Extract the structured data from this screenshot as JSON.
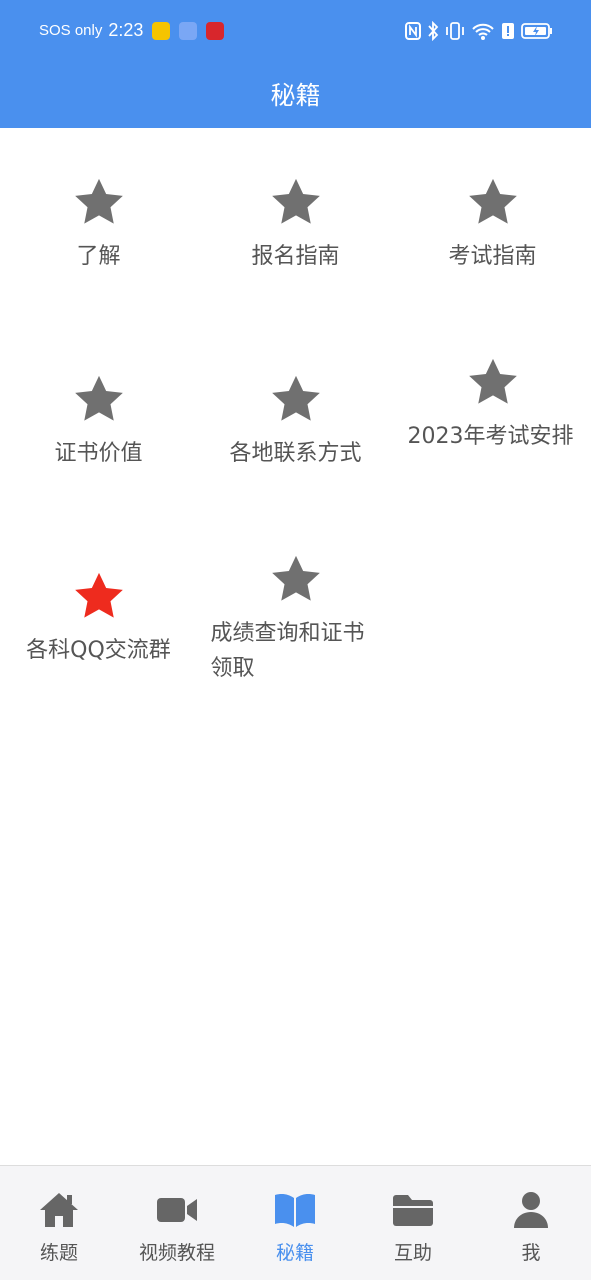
{
  "status_bar": {
    "carrier": "SOS only",
    "time": "2:23",
    "icons": [
      "nfc-icon",
      "bluetooth-icon",
      "vibrate-icon",
      "wifi-icon",
      "alert-icon",
      "battery-charging-icon"
    ]
  },
  "header": {
    "title": "秘籍",
    "background": "#4a90ee"
  },
  "grid": {
    "items": [
      {
        "label": "了解",
        "icon": "star-icon",
        "color": "#707070"
      },
      {
        "label": "报名指南",
        "icon": "star-icon",
        "color": "#707070"
      },
      {
        "label": "考试指南",
        "icon": "star-icon",
        "color": "#707070"
      },
      {
        "label": "证书价值",
        "icon": "star-icon",
        "color": "#707070"
      },
      {
        "label": "各地联系方式",
        "icon": "star-icon",
        "color": "#707070"
      },
      {
        "label": "2023年考试安排",
        "icon": "star-icon",
        "color": "#707070"
      },
      {
        "label": "各科QQ交流群",
        "icon": "star-icon",
        "color": "#ee2b1e"
      },
      {
        "label": "成绩查询和证书领取",
        "icon": "star-icon",
        "color": "#707070"
      }
    ]
  },
  "tabbar": {
    "tabs": [
      {
        "label": "练题",
        "icon": "home-icon",
        "active": false
      },
      {
        "label": "视频教程",
        "icon": "video-camera-icon",
        "active": false
      },
      {
        "label": "秘籍",
        "icon": "open-book-icon",
        "active": true
      },
      {
        "label": "互助",
        "icon": "folder-icon",
        "active": false
      },
      {
        "label": "我",
        "icon": "user-icon",
        "active": false
      }
    ],
    "active_color": "#4a90ee",
    "inactive_color": "#666666"
  }
}
